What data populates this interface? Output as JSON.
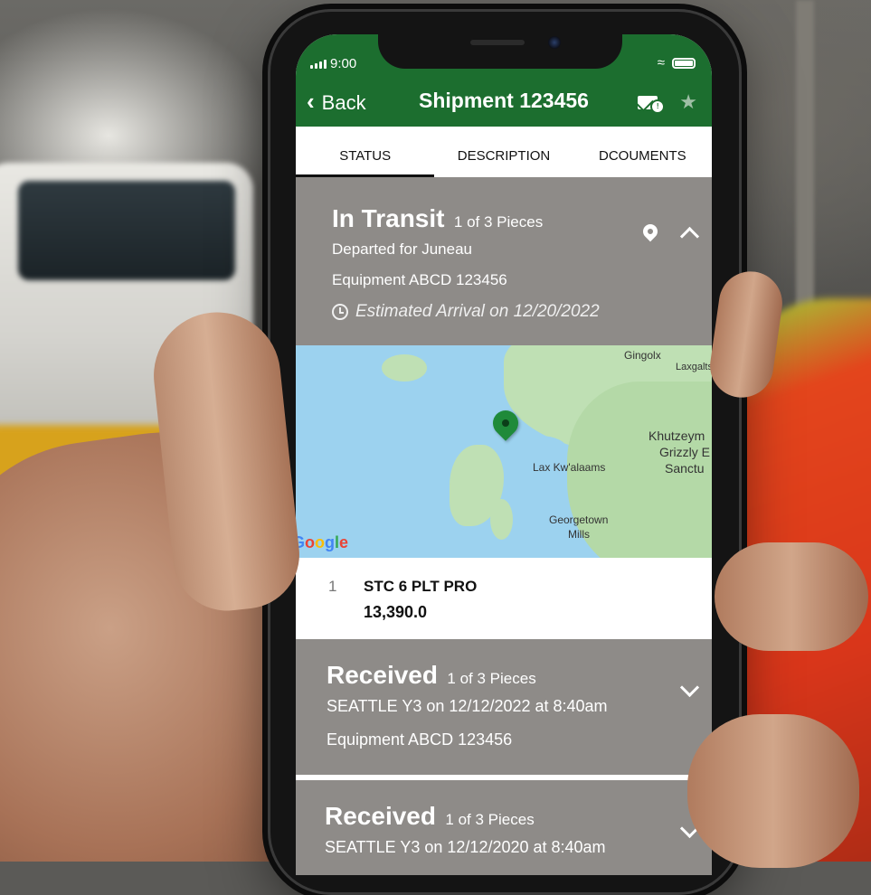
{
  "status_bar": {
    "time": "9:00"
  },
  "nav": {
    "back_label": "Back",
    "title": "Shipment 123456",
    "mail_icon": "mail-alert-icon",
    "star_icon": "star-icon"
  },
  "tabs": [
    {
      "label": "STATUS",
      "active": true
    },
    {
      "label": "DESCRIPTION",
      "active": false
    },
    {
      "label": "DCOUMENTS",
      "active": false
    }
  ],
  "events": [
    {
      "status": "In Transit",
      "pieces": "1 of 3 Pieces",
      "line1": "Departed for Juneau",
      "line2": "Equipment ABCD 123456",
      "eta": "Estimated Arrival on 12/20/2022",
      "expanded": true
    },
    {
      "status": "Received",
      "pieces": "1 of 3 Pieces",
      "line1": "SEATTLE Y3 on 12/12/2022 at 8:40am",
      "line2": "Equipment ABCD 123456",
      "expanded": false
    },
    {
      "status": "Received",
      "pieces": "1 of 3 Pieces",
      "line1": "SEATTLE Y3 on 12/12/2020 at 8:40am",
      "expanded": false
    }
  ],
  "map": {
    "labels": {
      "gingolx": "Gingolx",
      "laxgalts": "Laxgalts",
      "khutzeym": "Khutzeym",
      "grizzly": "Grizzly E",
      "sanctu": "Sanctu",
      "laxkwalaams": "Lax Kw'alaams",
      "georgetown": "Georgetown",
      "mills": "Mills"
    },
    "attribution": [
      "G",
      "o",
      "o",
      "g",
      "l",
      "e"
    ]
  },
  "piece": {
    "number": "1",
    "name": "STC 6 PLT PRO",
    "weight": "13,390.0"
  },
  "colors": {
    "header_green": "#1c6e2f",
    "section_gray": "#8e8b88",
    "map_pin": "#1f8a3a"
  }
}
